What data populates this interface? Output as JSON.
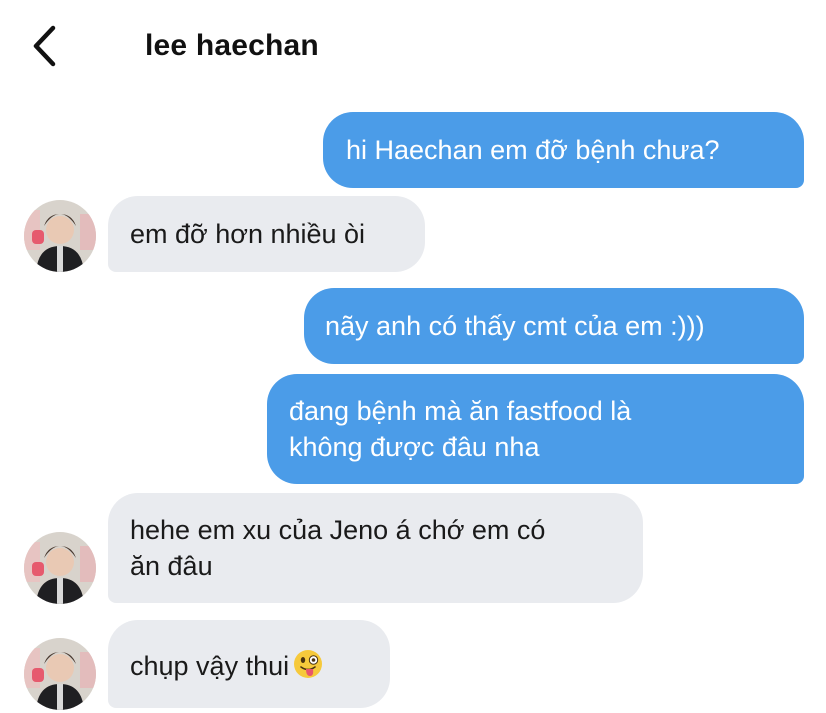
{
  "header": {
    "back_icon": "chevron-left-icon",
    "contact_name": "lee haechan"
  },
  "messages": [
    {
      "direction": "outgoing",
      "text": "hi Haechan em đỡ bệnh chưa?"
    },
    {
      "direction": "incoming",
      "text": "em đỡ hơn nhiều òi"
    },
    {
      "direction": "outgoing",
      "text": "nãy anh có thấy cmt của em :)))"
    },
    {
      "direction": "outgoing",
      "lines": [
        "đang bệnh mà ăn fastfood là",
        "không được đâu nha"
      ]
    },
    {
      "direction": "incoming",
      "lines": [
        "hehe em xu của Jeno á chớ em có",
        "ăn đâu"
      ]
    },
    {
      "direction": "incoming",
      "text": "chụp vậy thui",
      "emoji": "winking-face-with-tongue-icon"
    }
  ],
  "colors": {
    "outgoing_bubble": "#4b9ce8",
    "incoming_bubble": "#e9ebef",
    "outgoing_text": "#ffffff",
    "incoming_text": "#1a1a1a"
  }
}
